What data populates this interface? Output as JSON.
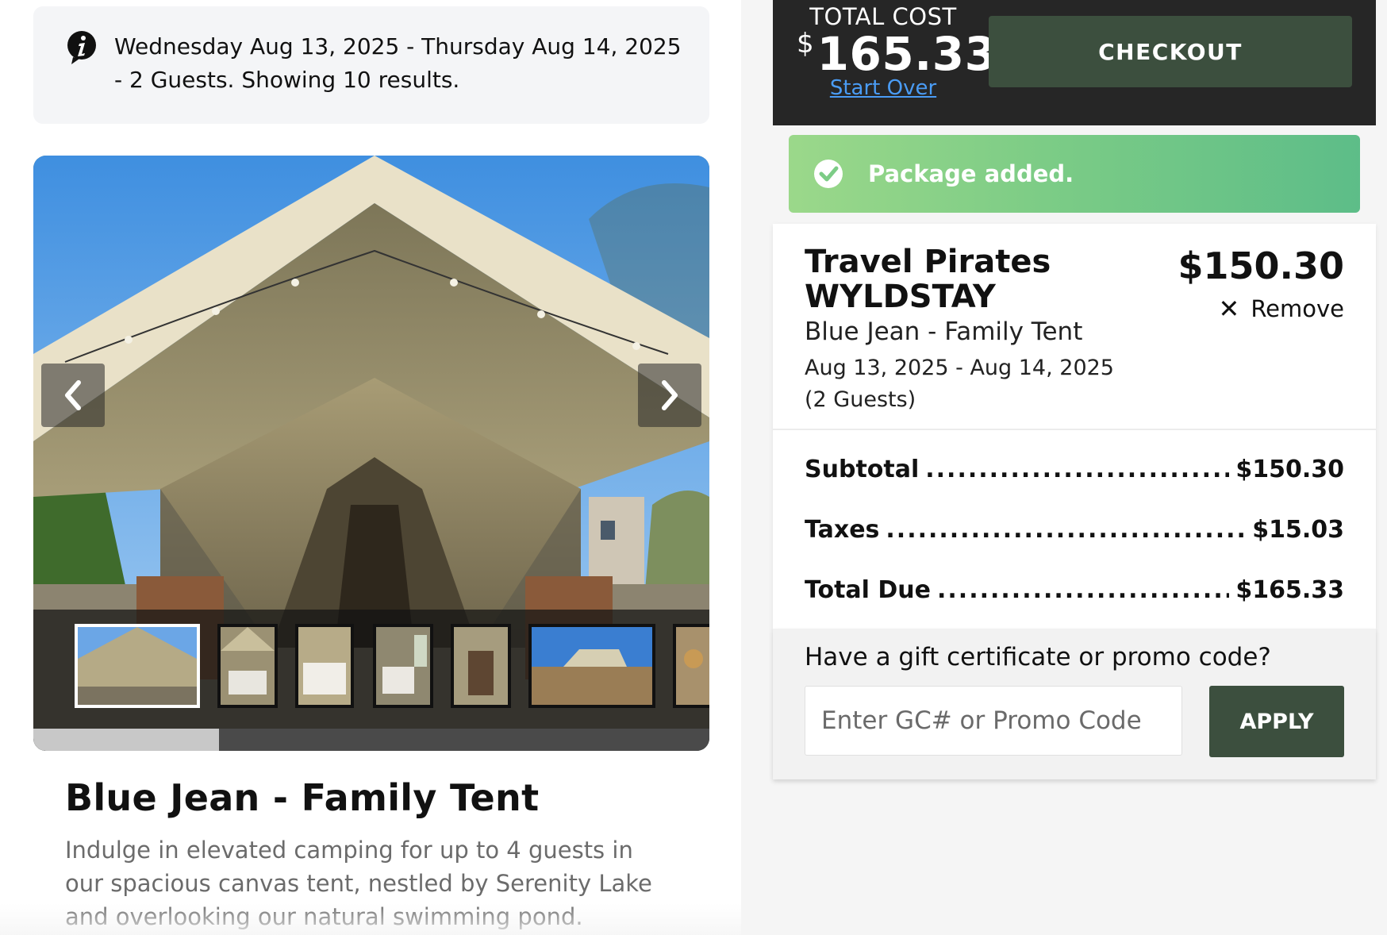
{
  "search_info": {
    "text": "Wednesday Aug 13, 2025 - Thursday Aug 14, 2025 - 2 Guests. Showing 10 results.",
    "icon": "info-icon"
  },
  "gallery": {
    "prev_icon": "chevron-left-icon",
    "next_icon": "chevron-right-icon",
    "thumbnail_count_visible": 7
  },
  "product": {
    "title": "Blue Jean - Family Tent",
    "description": "Indulge in elevated camping for up to 4 guests in our spacious canvas tent, nestled by Serenity Lake and overlooking our natural swimming pond."
  },
  "cost_bar": {
    "label": "TOTAL COST",
    "currency": "$",
    "amount": "165.33",
    "start_over": "Start Over",
    "checkout": "CHECKOUT"
  },
  "toast": {
    "text": "Package added.",
    "icon": "check-circle-icon"
  },
  "cart_item": {
    "vendor": "Travel Pirates WYLDSTAY",
    "price": "$150.30",
    "remove_label": "Remove",
    "name": "Blue Jean - Family Tent",
    "dates": "Aug 13, 2025 - Aug 14, 2025 (2 Guests)"
  },
  "summary": {
    "subtotal_label": "Subtotal",
    "subtotal_value": "$150.30",
    "taxes_label": "Taxes",
    "taxes_value": "$15.03",
    "total_label": "Total Due",
    "total_value": "$165.33"
  },
  "promo": {
    "label": "Have a gift certificate or promo code?",
    "placeholder": "Enter GC# or Promo Code",
    "apply": "APPLY"
  },
  "colors": {
    "dark_bar": "#262626",
    "button_green": "#3c4f3e",
    "link_blue": "#4a9cf5",
    "toast_start": "#9bd88a",
    "toast_end": "#5dbd88"
  }
}
